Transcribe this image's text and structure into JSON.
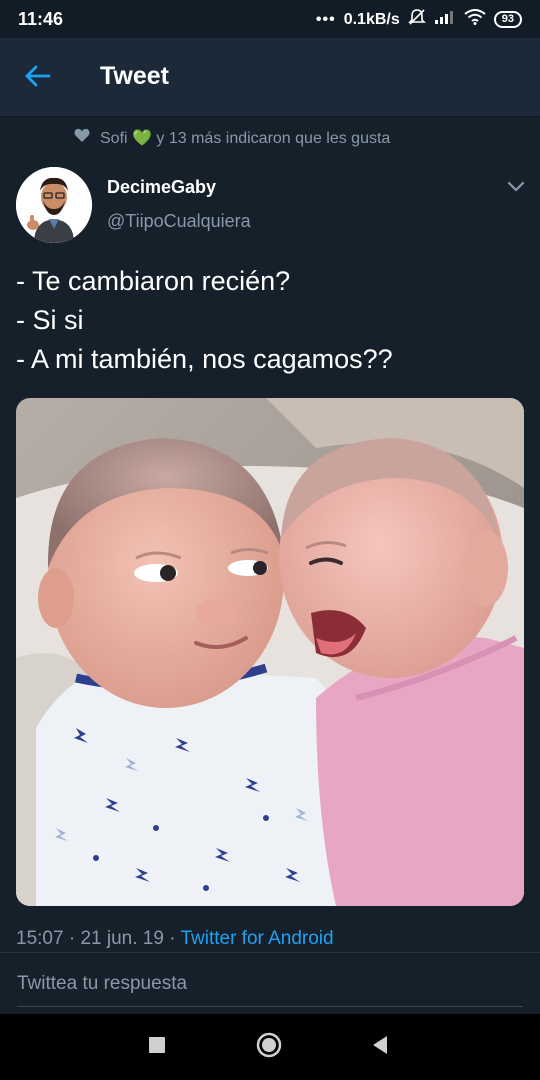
{
  "status_bar": {
    "time": "11:46",
    "network_speed": "0.1kB/s",
    "battery": "93",
    "icons": [
      "more-dots-icon",
      "mute-icon",
      "signal-icon",
      "wifi-icon",
      "battery-icon"
    ]
  },
  "app_bar": {
    "title": "Tweet",
    "back_icon": "arrow-left-icon",
    "accent_color": "#1da1f2"
  },
  "tweet": {
    "social_context": {
      "icon": "heart-icon",
      "name": "Sofi",
      "emoji": "💚",
      "rest": "y 13 más indicaron que les gusta"
    },
    "author": {
      "display_name": "DecimeGaby",
      "handle": "@TiipoCualquiera"
    },
    "menu_icon": "chevron-down-icon",
    "text_lines": [
      "- Te cambiaron recién?",
      "- Si si",
      "- A mi también, nos cagamos??"
    ],
    "media": {
      "type": "photo",
      "description_icon": "photo-two-babies"
    },
    "meta": {
      "time": "15:07",
      "separator": "·",
      "date": "21 jun. 19",
      "source": "Twitter for Android"
    }
  },
  "reply": {
    "placeholder": "Twittea tu respuesta"
  },
  "nav_bar": {
    "icons": [
      "recents-square-icon",
      "home-circle-icon",
      "back-triangle-icon"
    ]
  },
  "colors": {
    "background": "#15202b",
    "app_bar": "#1c2938",
    "secondary_text": "#8899a6",
    "link": "#1da1f2"
  }
}
